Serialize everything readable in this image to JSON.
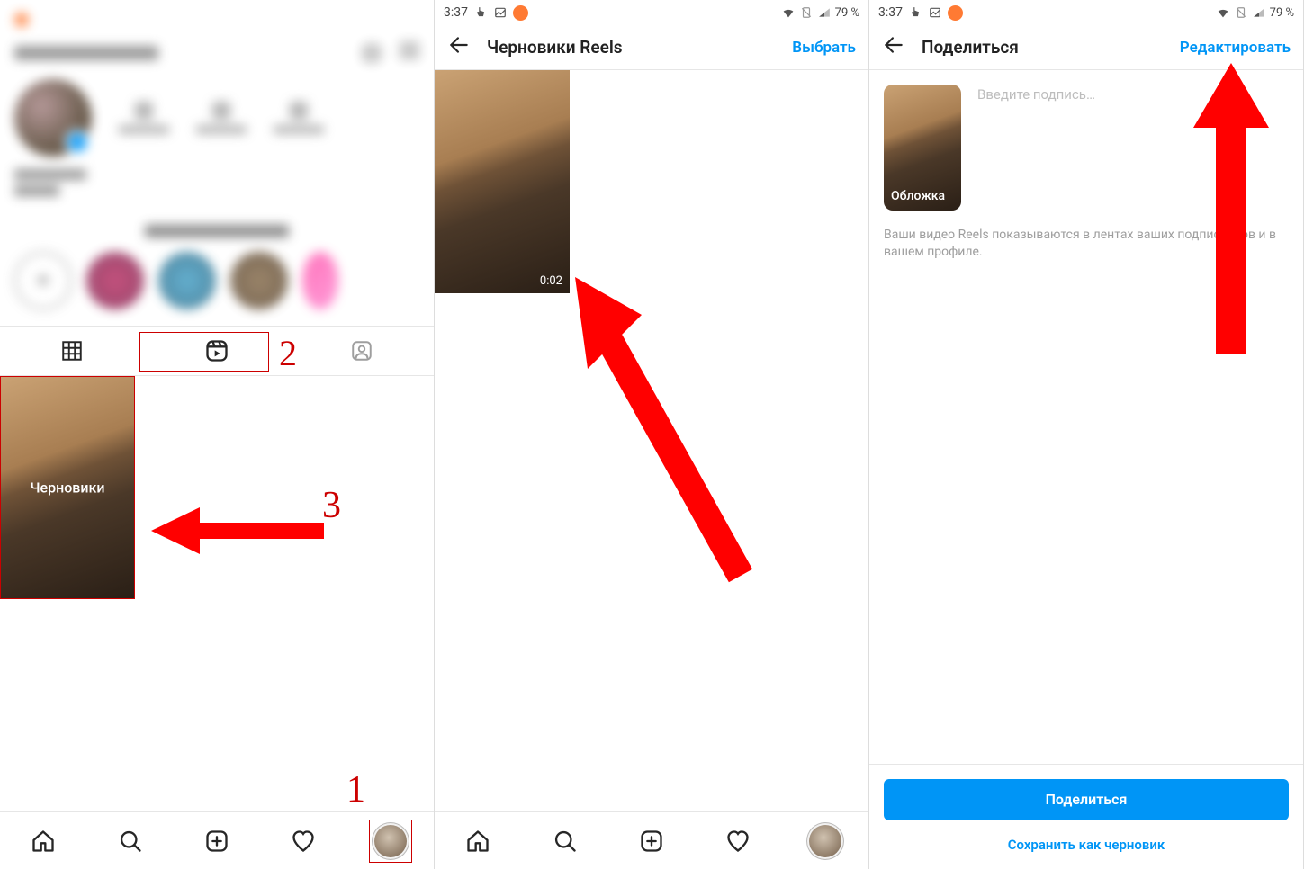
{
  "status": {
    "time": "3:37",
    "battery": "79 %",
    "icons": {
      "touch": "touch-icon",
      "image": "image-icon",
      "orange": "record-icon",
      "wifi": "wifi-icon",
      "net": "no-sim-icon",
      "signal": "signal-icon"
    }
  },
  "panel1": {
    "tabs": {
      "grid": "grid-icon",
      "reels": "reels-icon",
      "tagged": "tagged-icon"
    },
    "drafts_label": "Черновики",
    "annotations": {
      "step1": "1",
      "step2": "2",
      "step3": "3"
    }
  },
  "panel2": {
    "header": {
      "title": "Черновики Reels",
      "action": "Выбрать"
    },
    "thumb_duration": "0:02"
  },
  "panel3": {
    "header": {
      "title": "Поделиться",
      "action": "Редактировать"
    },
    "cover_label": "Обложка",
    "caption_placeholder": "Введите подпись…",
    "description": "Ваши видео Reels показываются в лентах ваших подписчиков и в вашем профиле.",
    "share_button": "Поделиться",
    "save_draft": "Сохранить как черновик"
  },
  "nav": {
    "home": "home-icon",
    "search": "search-icon",
    "add": "add-icon",
    "likes": "likes-icon",
    "profile": "profile-avatar"
  }
}
